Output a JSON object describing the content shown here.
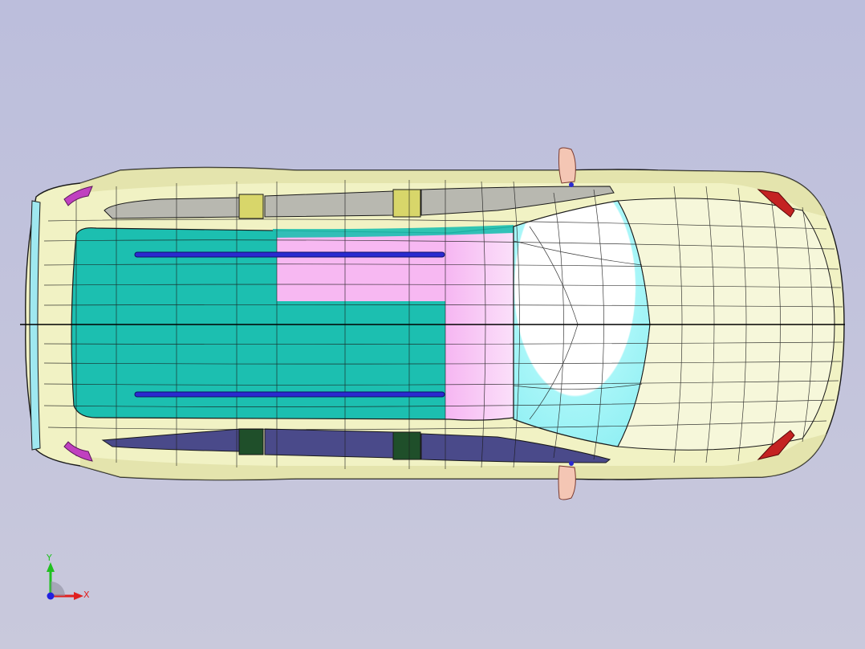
{
  "viewport": {
    "background_top": "#bcbedc",
    "background_bottom": "#c9c9dc"
  },
  "model": {
    "body_color": "#f1f2c4",
    "body_shadow": "#d8d99a",
    "mesh_line_color": "#1a1a1a",
    "roof_teal": "#1cbfb0",
    "roof_pink": "#f7b8f2",
    "windshield_cyan": "#a8f6f8",
    "windshield_white": "#ffffff",
    "side_window_color": "#b8b8b0",
    "side_window_dark": "#4a4a8a",
    "pillar_yellow": "#d8d66a",
    "pillar_green": "#1f4f2a",
    "roof_rail_color": "#2a2ad0",
    "mirror_color": "#f4c6b4",
    "tail_light_color": "#c42222",
    "accent_magenta": "#c040c0"
  },
  "triad": {
    "x_label": "X",
    "y_label": "Y",
    "x_color": "#e02020",
    "y_color": "#20c020",
    "z_color": "#2020e0"
  }
}
